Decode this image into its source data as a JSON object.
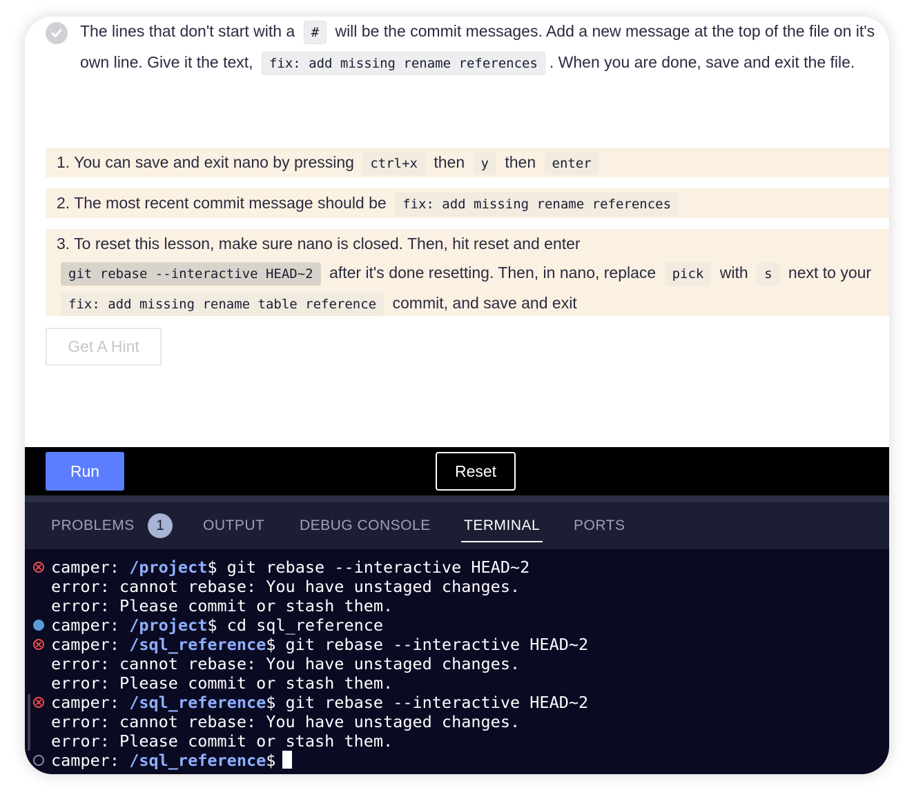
{
  "instructions": {
    "part1": "The lines that don't start with a",
    "code_hash": "#",
    "part2": "will be the commit messages. Add a new message at the top of the file on it's own line. Give it the text,",
    "code_message": "fix: add missing rename references",
    "part3": ". When you are done, save and exit the file."
  },
  "hints": {
    "h1": {
      "text1": "1. You can save and exit nano by pressing",
      "code1": "ctrl+x",
      "text2": "then",
      "code2": "y",
      "text3": "then",
      "code3": "enter"
    },
    "h2": {
      "text1": "2. The most recent commit message should be",
      "code1": "fix: add missing rename references"
    },
    "h3": {
      "text1": "3. To reset this lesson, make sure nano is closed. Then, hit reset and enter",
      "code1": "git rebase --interactive HEAD~2",
      "text2": "after it's done resetting. Then, in nano, replace",
      "code2": "pick",
      "text3": "with",
      "code3": "s",
      "text4": "next to your",
      "code4": "fix: add missing rename table reference",
      "text5": "commit, and save and exit"
    }
  },
  "buttons": {
    "hint": "Get A Hint",
    "run": "Run",
    "reset": "Reset"
  },
  "panel": {
    "tabs": [
      "PROBLEMS",
      "OUTPUT",
      "DEBUG CONSOLE",
      "TERMINAL",
      "PORTS"
    ],
    "problems_count": "1",
    "active_tab": "TERMINAL"
  },
  "terminal": {
    "user": "camper:",
    "lines": [
      {
        "status": "error",
        "path": "/project",
        "cmd": "$ git rebase --interactive HEAD~2"
      },
      {
        "status": "",
        "text": "error: cannot rebase: You have unstaged changes."
      },
      {
        "status": "",
        "text": "error: Please commit or stash them."
      },
      {
        "status": "success",
        "path": "/project",
        "cmd": "$ cd sql_reference"
      },
      {
        "status": "error",
        "path": "/sql_reference",
        "cmd": "$ git rebase --interactive HEAD~2"
      },
      {
        "status": "",
        "text": "error: cannot rebase: You have unstaged changes."
      },
      {
        "status": "",
        "text": "error: Please commit or stash them."
      },
      {
        "status": "error",
        "path": "/sql_reference",
        "cmd": "$ git rebase --interactive HEAD~2"
      },
      {
        "status": "",
        "text": "error: cannot rebase: You have unstaged changes."
      },
      {
        "status": "",
        "text": "error: Please commit or stash them."
      },
      {
        "status": "idle",
        "path": "/sql_reference",
        "cmd": "$"
      }
    ]
  },
  "colors": {
    "run": "#5b7eff",
    "hint_bg": "#fbf1e2",
    "terminal_bg": "#0a0a23",
    "path": "#8fb0ff",
    "error": "#f14c4c"
  }
}
